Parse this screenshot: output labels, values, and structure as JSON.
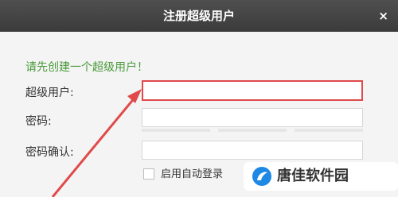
{
  "dialog": {
    "title": "注册超级用户",
    "close_symbol": "×"
  },
  "hint": "请先创建一个超级用户！",
  "form": {
    "username_label": "超级用户:",
    "password_label": "密码:",
    "confirm_label": "密码确认:"
  },
  "auto_login_label": "启用自动登录",
  "watermark": {
    "text": "唐佳软件园"
  },
  "colors": {
    "hint_green": "#4a9a3a",
    "highlight_red": "#e04a4a",
    "titlebar": "#454545"
  }
}
